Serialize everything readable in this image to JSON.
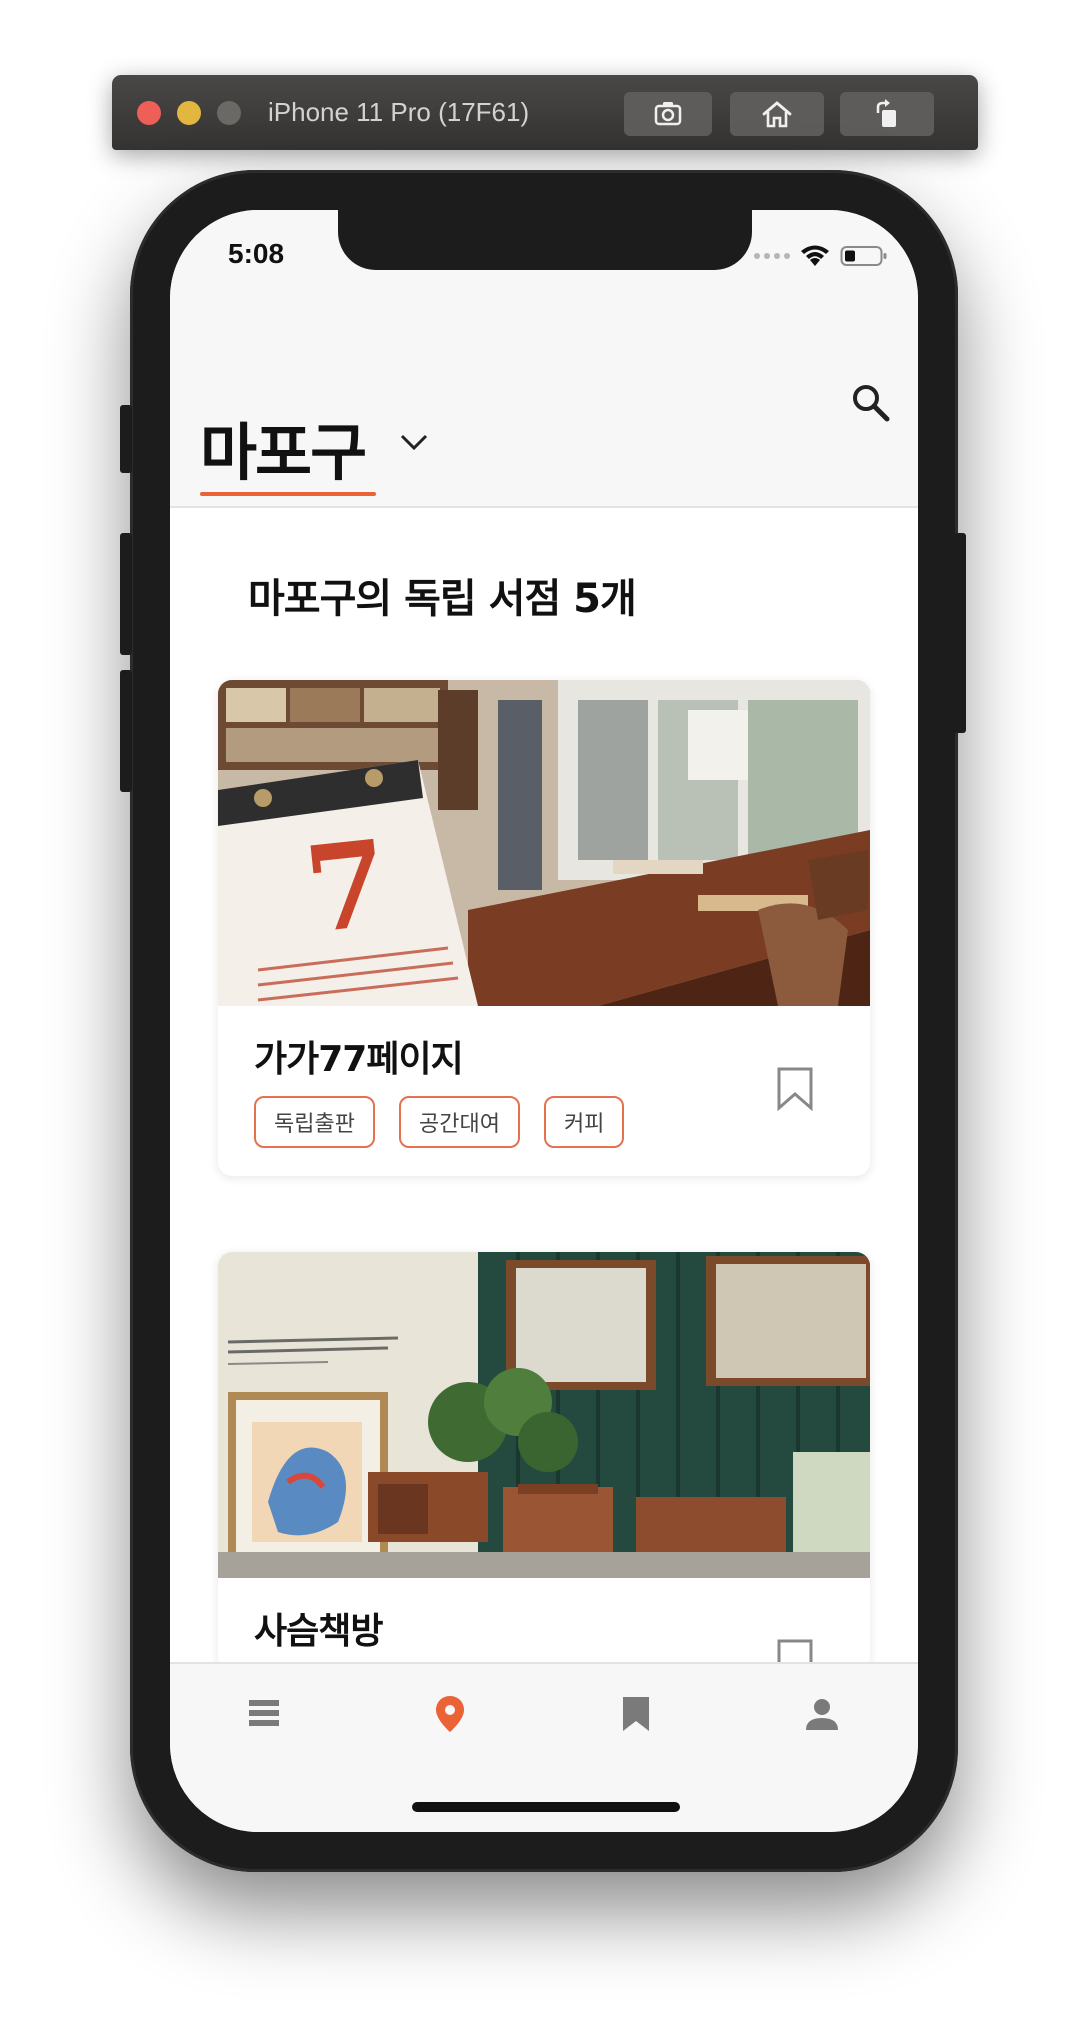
{
  "window": {
    "title": "iPhone 11 Pro (17F61)",
    "buttons": [
      "screenshot-icon",
      "home-icon",
      "rotate-icon"
    ]
  },
  "status_bar": {
    "time": "5:08"
  },
  "header": {
    "district": "마포구"
  },
  "section": {
    "title": "마포구의 독립 서점 5개"
  },
  "stores": [
    {
      "name": "가가77페이지",
      "tags": [
        "독립출판",
        "공간대여",
        "커피"
      ],
      "bookmarked": false
    },
    {
      "name": "사슴책방",
      "tags": [],
      "bookmarked": false
    }
  ],
  "tabbar": {
    "items": [
      "list-icon",
      "location-pin-icon",
      "bookmark-icon",
      "profile-icon"
    ],
    "active": "location-pin-icon",
    "accent": "#ea6236"
  }
}
